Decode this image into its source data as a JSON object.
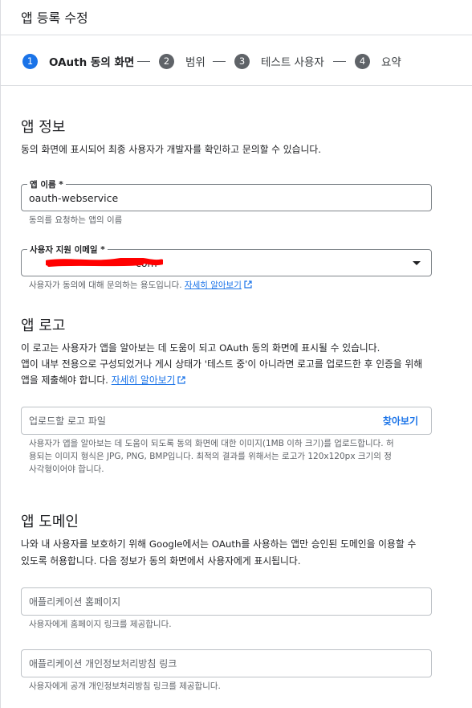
{
  "header": {
    "title": "앱 등록 수정"
  },
  "steps": [
    {
      "num": "1",
      "label": "OAuth 동의 화면",
      "active": true
    },
    {
      "num": "2",
      "label": "범위"
    },
    {
      "num": "3",
      "label": "테스트 사용자"
    },
    {
      "num": "4",
      "label": "요약"
    }
  ],
  "app_info": {
    "title": "앱 정보",
    "description": "동의 화면에 표시되어 최종 사용자가 개발자를 확인하고 문의할 수 있습니다.",
    "app_name": {
      "label": "앱 이름 *",
      "value": "oauth-webservice",
      "hint": "동의를 요청하는 앱의 이름"
    },
    "support_email": {
      "label": "사용자 지원 이메일 *",
      "value_suffix": "com",
      "hint": "사용자가 동의에 대해 문의하는 용도입니다.",
      "link": "자세히 알아보기"
    }
  },
  "app_logo": {
    "title": "앱 로고",
    "description_line1": "이 로고는 사용자가 앱을 알아보는 데 도움이 되고 OAuth 동의 화면에 표시될 수 있습니다.",
    "description_line2": "앱이 내부 전용으로 구성되었거나 게시 상태가 '테스트 중'이 아니라면 로고를 업로드한 후 인증을 위해",
    "description_line3": "앱을 제출해야 합니다.",
    "link": "자세히 알아보기",
    "upload": {
      "placeholder": "업로드할 로고 파일",
      "browse_label": "찾아보기"
    },
    "hint_line1": "사용자가 앱을 알아보는 데 도움이 되도록 동의 화면에 대한 이미지(1MB 이하 크기)를 업로드합니다. 허",
    "hint_line2": "용되는 이미지 형식은 JPG, PNG, BMP입니다. 최적의 결과를 위해서는 로고가 120x120px 크기의 정",
    "hint_line3": "사각형이어야 합니다."
  },
  "app_domain": {
    "title": "앱 도메인",
    "description_line1": "나와 내 사용자를 보호하기 위해 Google에서는 OAuth를 사용하는 앱만 승인된 도메인을 이용할 수",
    "description_line2": "있도록 허용합니다. 다음 정보가 동의 화면에서 사용자에게 표시됩니다.",
    "homepage": {
      "placeholder": "애플리케이션 홈페이지",
      "hint": "사용자에게 홈페이지 링크를 제공합니다."
    },
    "privacy": {
      "placeholder": "애플리케이션 개인정보처리방침 링크",
      "hint": "사용자에게 공개 개인정보처리방침 링크를 제공합니다."
    }
  },
  "colors": {
    "accent": "#1a73e8",
    "step_inactive": "#5f6368",
    "redaction": "#ff0000"
  }
}
